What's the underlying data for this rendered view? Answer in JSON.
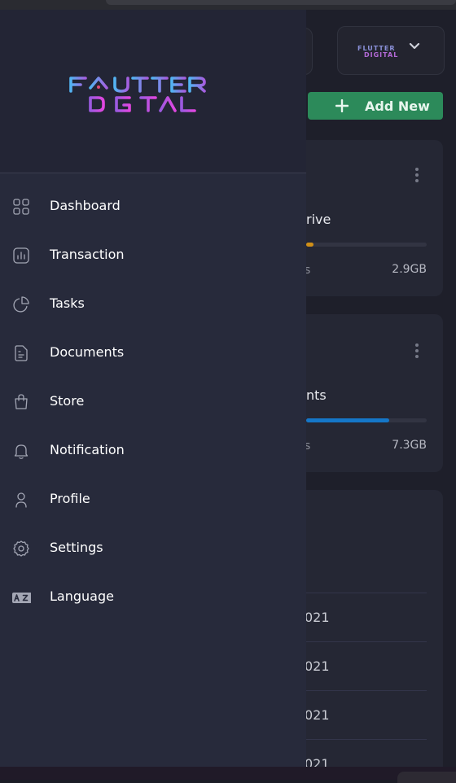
{
  "app": {
    "brand": {
      "line1": "FLUTTER",
      "line2": "DIGITAL",
      "mini_line1": "FLUTTER",
      "mini_line2": "DIGITAL"
    }
  },
  "sidebar": {
    "items": [
      {
        "label": "Dashboard",
        "icon": "dashboard-grid-icon"
      },
      {
        "label": "Transaction",
        "icon": "chart-icon"
      },
      {
        "label": "Tasks",
        "icon": "pie-chart-icon"
      },
      {
        "label": "Documents",
        "icon": "document-icon"
      },
      {
        "label": "Store",
        "icon": "bag-icon"
      },
      {
        "label": "Notification",
        "icon": "bell-icon"
      },
      {
        "label": "Profile",
        "icon": "profile-icon"
      },
      {
        "label": "Settings",
        "icon": "settings-icon"
      },
      {
        "label": "Language",
        "icon": "language-icon"
      }
    ]
  },
  "header": {
    "add_new_label": "Add New"
  },
  "storage_cards": [
    {
      "title": "rive",
      "subtitle": "s",
      "size": "2.9GB",
      "progress_color": "#d08f17"
    },
    {
      "title": "nts",
      "subtitle": "s",
      "size": "7.3GB",
      "progress_color": "#1577c8"
    }
  ],
  "recent_list": {
    "rows": [
      {
        "date": "021"
      },
      {
        "date": "021"
      },
      {
        "date": "021"
      },
      {
        "date": "021"
      }
    ]
  },
  "colors": {
    "drawer_bg": "#272a3b",
    "add_button": "#2c8a5a",
    "logo_top": "#5aa8f0",
    "logo_bottom": "#c258e6"
  }
}
